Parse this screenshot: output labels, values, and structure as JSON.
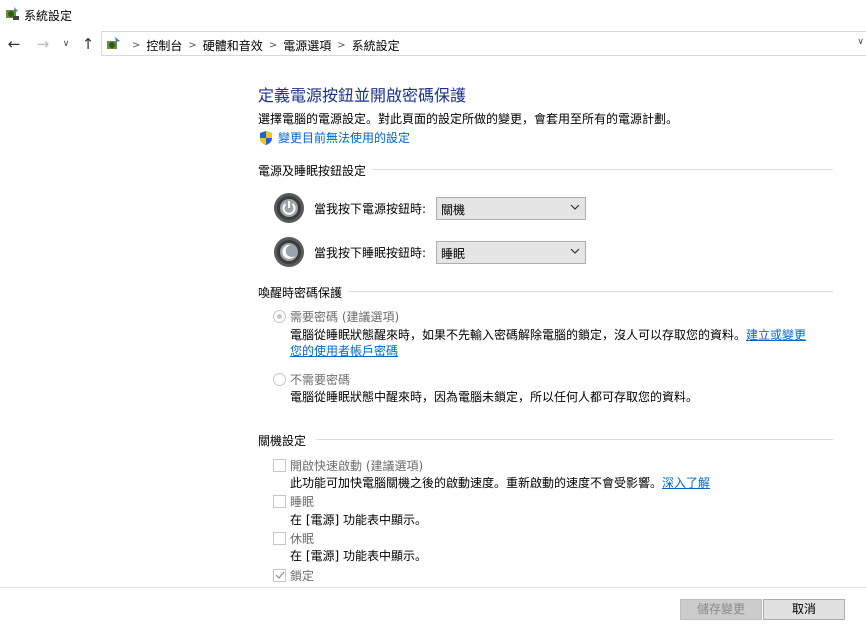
{
  "window": {
    "title": "系統設定"
  },
  "nav": {
    "back": "←",
    "forward": "→",
    "recent": "∨",
    "up": "↑"
  },
  "breadcrumb": [
    "控制台",
    "硬體和音效",
    "電源選項",
    "系統設定"
  ],
  "page": {
    "title": "定義電源按鈕並開啟密碼保護",
    "description": "選擇電腦的電源設定。對此頁面的設定所做的變更，會套用至所有的電源計劃。",
    "change_link": "變更目前無法使用的設定"
  },
  "power_buttons": {
    "header": "電源及睡眠按鈕設定",
    "power_label": "當我按下電源按鈕時:",
    "power_value": "關機",
    "sleep_label": "當我按下睡眠按鈕時:",
    "sleep_value": "睡眠"
  },
  "wake_password": {
    "header": "喚醒時密碼保護",
    "require_label": "需要密碼 (建議選項)",
    "require_desc_1": "電腦從睡眠狀態醒來時，如果不先輸入密碼解除電腦的鎖定，沒人可以存取您的資料。",
    "require_link_1": "建立或變更",
    "require_link_2": "您的使用者帳戶密碼",
    "norequire_label": "不需要密碼",
    "norequire_desc": "電腦從睡眠狀態中醒來時，因為電腦未鎖定，所以任何人都可存取您的資料。"
  },
  "shutdown": {
    "header": "關機設定",
    "fast_label": "開啟快速啟動 (建議選項)",
    "fast_desc": "此功能可加快電腦關機之後的啟動速度。重新啟動的速度不會受影響。",
    "fast_link": "深入了解",
    "sleep_label": "睡眠",
    "sleep_desc": "在 [電源] 功能表中顯示。",
    "hibernate_label": "休眠",
    "hibernate_desc": "在 [電源] 功能表中顯示。",
    "lock_label": "鎖定"
  },
  "footer": {
    "save": "儲存變更",
    "cancel": "取消"
  },
  "colors": {
    "title_blue": "#1e3287",
    "link_blue": "#0066cc",
    "disabled_text": "#6d6d6d"
  }
}
